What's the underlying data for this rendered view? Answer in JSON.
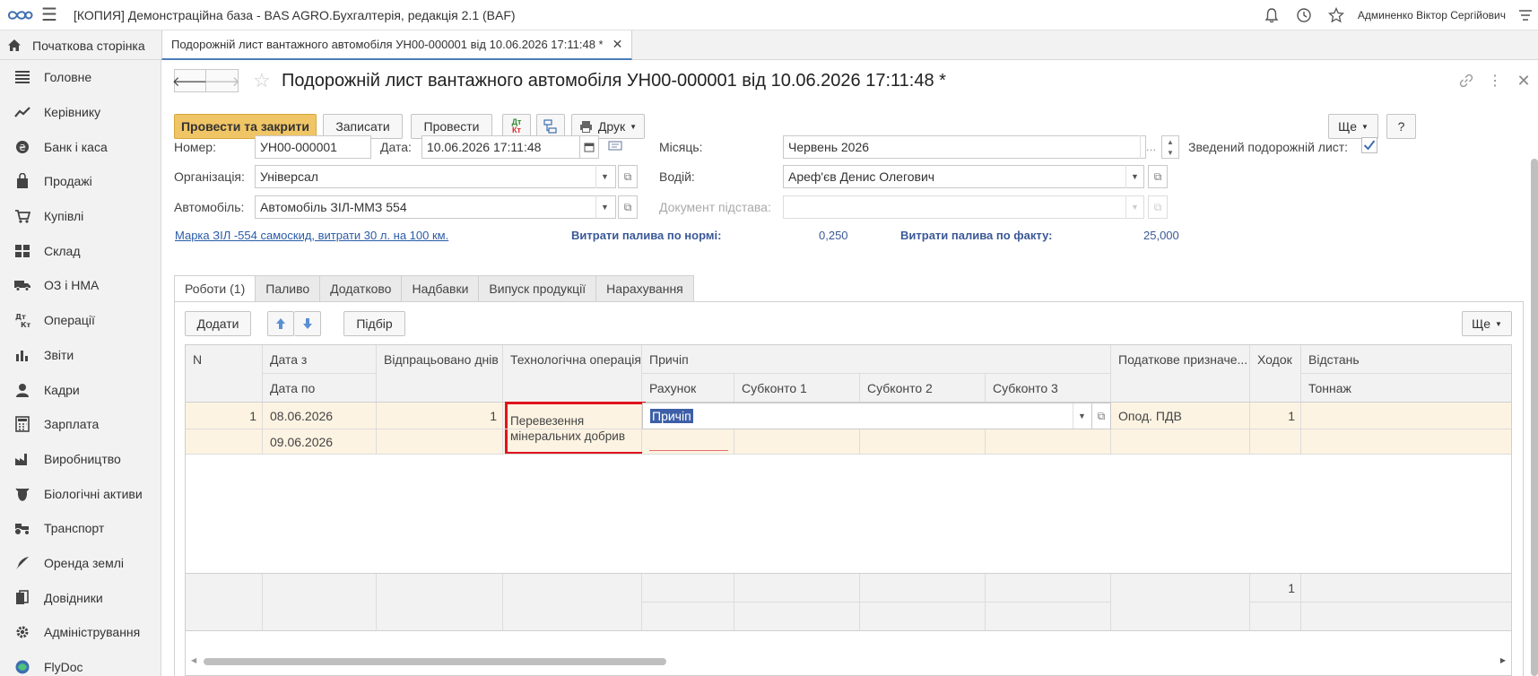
{
  "app": {
    "title": "[КОПИЯ] Демонстраційна база - BAS AGRO.Бухгалтерія, редакція 2.1  (BAF)",
    "user": "Админенко Віктор Сергійович"
  },
  "tabs": {
    "home": "Початкова сторінка",
    "doc": "Подорожній лист вантажного автомобіля УН00-000001 від 10.06.2026 17:11:48 *"
  },
  "sidebar": {
    "items": [
      {
        "label": "Головне",
        "icon": "menu-lines-icon"
      },
      {
        "label": "Керівнику",
        "icon": "trend-icon"
      },
      {
        "label": "Банк і каса",
        "icon": "coin-icon"
      },
      {
        "label": "Продажі",
        "icon": "bag-icon"
      },
      {
        "label": "Купівлі",
        "icon": "cart-icon"
      },
      {
        "label": "Склад",
        "icon": "warehouse-icon"
      },
      {
        "label": "ОЗ і НМА",
        "icon": "truck-icon"
      },
      {
        "label": "Операції",
        "icon": "dtkt-icon"
      },
      {
        "label": "Звіти",
        "icon": "bar-chart-icon"
      },
      {
        "label": "Кадри",
        "icon": "person-icon"
      },
      {
        "label": "Зарплата",
        "icon": "calculator-icon"
      },
      {
        "label": "Виробництво",
        "icon": "factory-icon"
      },
      {
        "label": "Біологічні активи",
        "icon": "cow-icon"
      },
      {
        "label": "Транспорт",
        "icon": "tractor-icon"
      },
      {
        "label": "Оренда землі",
        "icon": "feather-icon"
      },
      {
        "label": "Довідники",
        "icon": "books-icon"
      },
      {
        "label": "Адміністрування",
        "icon": "gear-icon"
      },
      {
        "label": "FlyDoc",
        "icon": "flydoc-icon"
      }
    ]
  },
  "form": {
    "title": "Подорожній лист вантажного автомобіля УН00-000001 від 10.06.2026 17:11:48 *",
    "toolbar": {
      "post_close": "Провести та закрити",
      "save": "Записати",
      "post": "Провести",
      "print": "Друк",
      "more": "Ще",
      "help": "?"
    },
    "fields": {
      "number_label": "Номер:",
      "number": "УН00-000001",
      "date_label": "Дата:",
      "date": "10.06.2026 17:11:48",
      "month_label": "Місяць:",
      "month": "Червень 2026",
      "summary_label": "Зведений подорожній лист:",
      "summary_checked": true,
      "org_label": "Організація:",
      "org": "Універсал",
      "driver_label": "Водій:",
      "driver": "Ареф'єв Денис Олегович",
      "car_label": "Автомобіль:",
      "car": "Автомобіль ЗІЛ-ММЗ  554",
      "basis_label": "Документ підстава:",
      "basis": ""
    },
    "info": {
      "brand_link": "Марка ЗІЛ -554 самоскид, витрати 30 л. на 100 км.",
      "norm_label": "Витрати палива по нормі:",
      "norm_value": "0,250",
      "fact_label": "Витрати палива по факту:",
      "fact_value": "25,000"
    },
    "tabs": [
      "Роботи (1)",
      "Паливо",
      "Додатково",
      "Надбавки",
      "Випуск продукції",
      "Нарахування"
    ],
    "table_toolbar": {
      "add": "Додати",
      "pick": "Підбір",
      "more": "Ще"
    },
    "table": {
      "headers_top": [
        "N",
        "Дата з",
        "Відпрацьовано днів",
        "Технологічна операція",
        "Причіп",
        "Податкове призначе...",
        "Ходок",
        "Відстань"
      ],
      "headers_bottom": [
        "Дата по",
        "Рахунок",
        "Субконто 1",
        "Субконто 2",
        "Субконто 3",
        "Тоннаж"
      ],
      "rows": [
        {
          "n": "1",
          "date_from": "08.06.2026",
          "date_to": "09.06.2026",
          "days": "1",
          "operation_line1": "Перевезення",
          "operation_line2": "мінеральних добрив",
          "trailer": "Причіп",
          "tax": "Опод. ПДВ",
          "trips": "1"
        }
      ],
      "footer_trips": "1"
    }
  },
  "colors": {
    "primary_button": "#f0c565",
    "selected_row": "#fdf3e2",
    "highlight_border": "#e0141e",
    "link": "#2a5ca8"
  }
}
